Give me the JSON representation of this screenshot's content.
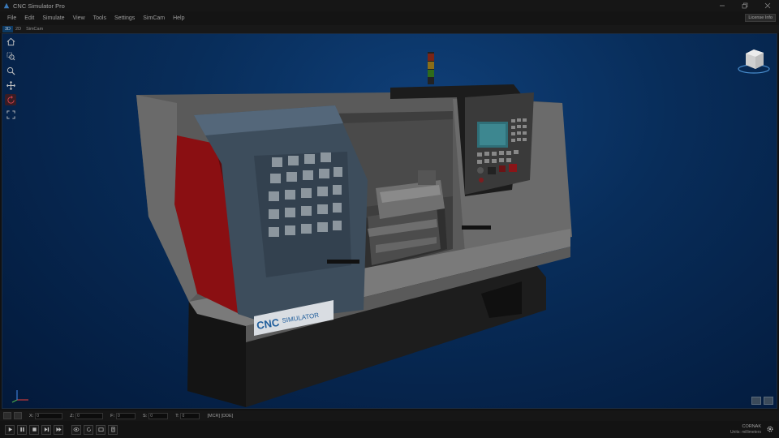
{
  "window": {
    "title": "CNC Simulator Pro",
    "license_badge": "License Info"
  },
  "menu": [
    "File",
    "Edit",
    "Simulate",
    "View",
    "Tools",
    "Settings",
    "SimCam",
    "Help"
  ],
  "view_tabs": [
    "3D",
    "2D",
    "SimCam"
  ],
  "viewport_tools": [
    {
      "name": "home-icon",
      "active": false
    },
    {
      "name": "zoom-region-icon",
      "active": false
    },
    {
      "name": "zoom-icon",
      "active": false
    },
    {
      "name": "pan-icon",
      "active": false
    },
    {
      "name": "rotate-icon",
      "active": true
    },
    {
      "name": "fit-view-icon",
      "active": false
    }
  ],
  "machine": {
    "brand": "CNC",
    "brand_suffix": "SIMULATOR"
  },
  "coords": {
    "x_label": "X:",
    "x_value": "0",
    "z_label": "Z:",
    "z_value": "0",
    "f_label": "F:",
    "f_value": "0",
    "s_label": "S:",
    "s_value": "0",
    "t_label": "T:",
    "t_value": "0",
    "mode_text": "[MCR] [DDE]"
  },
  "status": {
    "line1": "CORNAK",
    "line2": "Units: millimeters"
  },
  "colors": {
    "accent": "#0d3a63",
    "machine_red": "#8a0f12",
    "viewport_bg": "#082d5a"
  }
}
